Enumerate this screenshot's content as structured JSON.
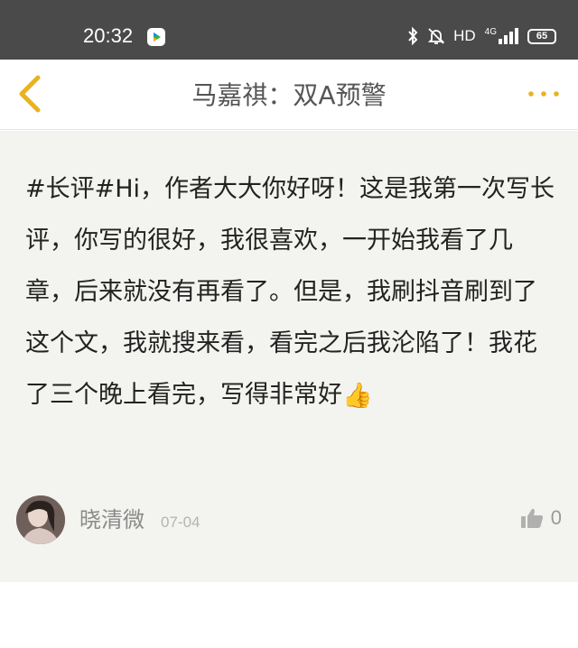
{
  "status_bar": {
    "time": "20:32",
    "network_label": "HD",
    "signal_label": "4G",
    "battery_level": "65",
    "icons": [
      "video-app-icon",
      "bluetooth-icon",
      "mute-bell-icon",
      "signal-icon",
      "battery-icon"
    ]
  },
  "nav": {
    "title": "马嘉祺：双A预警",
    "back_icon": "chevron-left-icon",
    "more_icon": "more-dots-icon",
    "accent_color": "#e8b320"
  },
  "review": {
    "text": "#长评#Hi，作者大大你好呀！这是我第一次写长评，你写的很好，我很喜欢，一开始我看了几章，后来就没有再看了。但是，我刷抖音刷到了这个文，我就搜来看，看完之后我沦陷了！我花了三个晚上看完，写得非常好",
    "emoji": "👍",
    "author": "晓清微",
    "date": "07-04",
    "likes": "0"
  }
}
